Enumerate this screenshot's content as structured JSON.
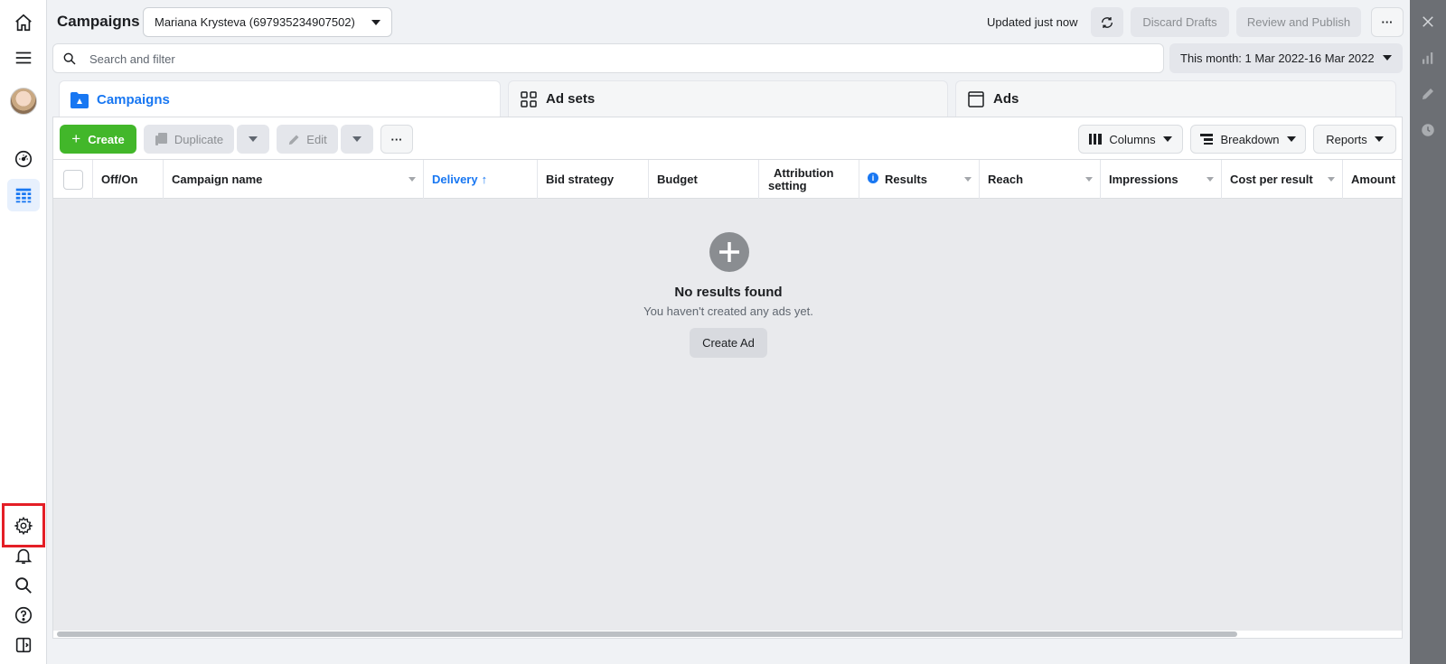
{
  "header": {
    "title": "Campaigns",
    "account": "Mariana Krysteva (697935234907502)",
    "updated": "Updated just now",
    "discard_label": "Discard Drafts",
    "publish_label": "Review and Publish",
    "more_label": "···"
  },
  "search": {
    "placeholder": "Search and filter",
    "date_range": "This month: 1 Mar 2022-16 Mar 2022"
  },
  "tabs": [
    {
      "label": "Campaigns"
    },
    {
      "label": "Ad sets"
    },
    {
      "label": "Ads"
    }
  ],
  "toolbar": {
    "create_label": "Create",
    "duplicate_label": "Duplicate",
    "edit_label": "Edit",
    "more_label": "···",
    "columns_label": "Columns",
    "breakdown_label": "Breakdown",
    "reports_label": "Reports"
  },
  "table": {
    "columns": [
      {
        "label": "Off/On"
      },
      {
        "label": "Campaign name"
      },
      {
        "label": "Delivery"
      },
      {
        "label": "Bid strategy"
      },
      {
        "label": "Budget"
      },
      {
        "label": "Attribution"
      },
      {
        "label": "setting"
      },
      {
        "label": "Results"
      },
      {
        "label": "Reach"
      },
      {
        "label": "Impressions"
      },
      {
        "label": "Cost per result"
      },
      {
        "label": "Amount"
      }
    ]
  },
  "empty_state": {
    "title": "No results found",
    "subtitle": "You haven't created any ads yet.",
    "button_label": "Create Ad"
  },
  "colors": {
    "accent": "#1877f2",
    "create_green": "#42b72a",
    "highlight_red": "#e41e26"
  },
  "icons": [
    "home-icon",
    "menu-icon",
    "dashboard-icon",
    "table-icon",
    "gear-icon",
    "bell-icon",
    "search-icon",
    "help-icon",
    "panel-toggle-icon",
    "close-icon",
    "bar-chart-icon",
    "pencil-icon",
    "clock-icon",
    "refresh-icon",
    "plus-icon"
  ]
}
